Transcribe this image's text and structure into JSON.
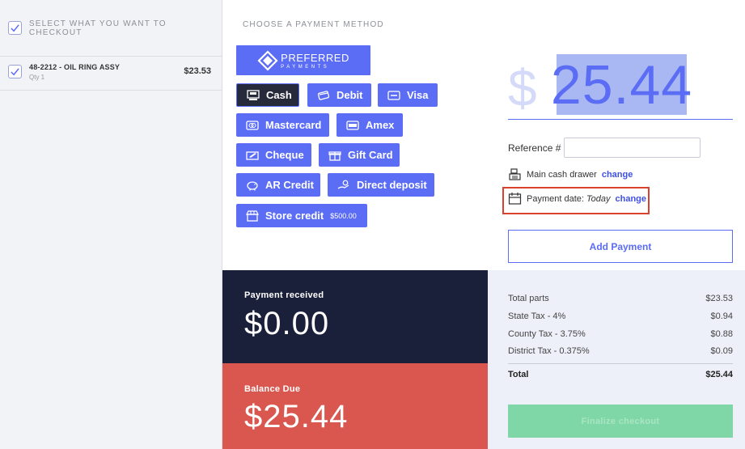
{
  "left": {
    "select_all_label": "SELECT WHAT YOU WANT TO CHECKOUT",
    "items": [
      {
        "name": "48-2212 - OIL RING ASSY",
        "qty": "Qty 1",
        "price": "$23.53"
      }
    ]
  },
  "payment": {
    "section_title": "CHOOSE A PAYMENT METHOD",
    "preferred": {
      "line1": "PREFERRED",
      "line2": "PAYMENTS"
    },
    "methods": {
      "cash": "Cash",
      "debit": "Debit",
      "visa": "Visa",
      "mastercard": "Mastercard",
      "amex": "Amex",
      "cheque": "Cheque",
      "gift_card": "Gift Card",
      "ar_credit": "AR Credit",
      "direct_deposit": "Direct deposit",
      "store_credit": "Store credit",
      "store_credit_balance": "$500.00"
    },
    "selected_method": "Cash"
  },
  "amount": {
    "currency_symbol": "$",
    "value": "25.44"
  },
  "reference": {
    "label": "Reference",
    "hash": "#",
    "value": ""
  },
  "drawer": {
    "label": "Main cash drawer",
    "change": "change"
  },
  "payment_date": {
    "label": "Payment date:",
    "value": "Today",
    "change": "change"
  },
  "add_payment_label": "Add Payment",
  "received": {
    "label": "Payment received",
    "amount": "$0.00"
  },
  "balance": {
    "label": "Balance Due",
    "amount": "$25.44"
  },
  "summary": {
    "rows": [
      {
        "label": "Total parts",
        "value": "$23.53"
      },
      {
        "label": "State Tax - 4%",
        "value": "$0.94"
      },
      {
        "label": "County Tax - 3.75%",
        "value": "$0.88"
      },
      {
        "label": "District Tax - 0.375%",
        "value": "$0.09"
      }
    ],
    "total": {
      "label": "Total",
      "value": "$25.44"
    }
  },
  "finalize_label": "Finalize checkout",
  "colors": {
    "primary": "#5b6cf5",
    "dark_panel": "#1a1f3a",
    "due_panel": "#d9574e",
    "finalize": "#7fd6a6",
    "highlight_box": "#d9432e"
  }
}
